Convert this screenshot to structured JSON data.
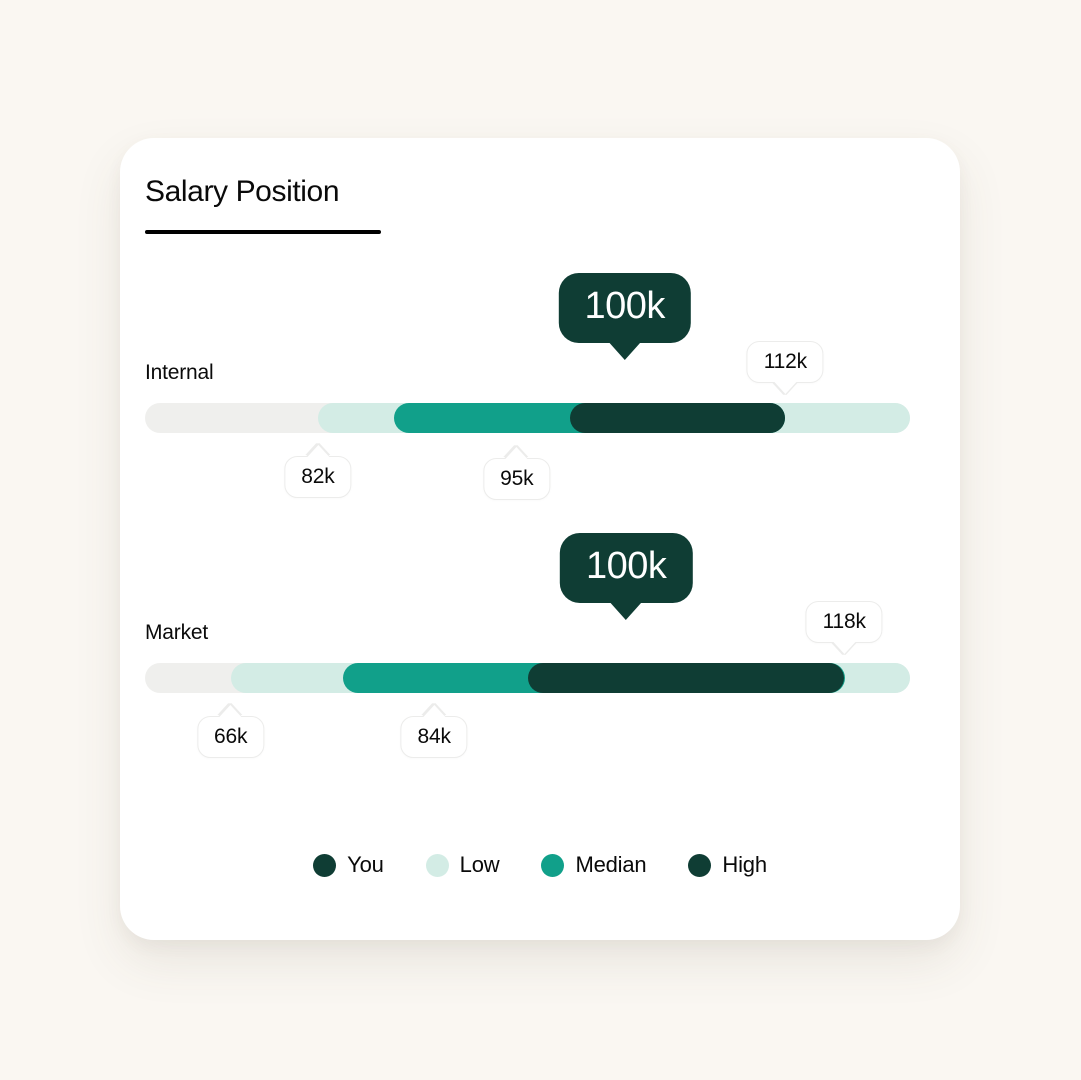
{
  "card": {
    "title": "Salary Position"
  },
  "colors": {
    "background": "#faf7f2",
    "card": "#ffffff",
    "track": "#efefed",
    "you": "#0f3d34",
    "low": "#d3ece5",
    "median": "#11a08a",
    "high": "#0f3d34",
    "text": "#0a0a0a"
  },
  "rows": [
    {
      "label": "Internal",
      "you": {
        "text": "100k",
        "left_pct": 62.7
      },
      "low": {
        "text": "82k",
        "left_pct": 22.6
      },
      "median": {
        "text": "95k",
        "left_pct": 48.6
      },
      "high": {
        "text": "112k",
        "left_pct": 83.7
      }
    },
    {
      "label": "Market",
      "you": {
        "text": "100k",
        "left_pct": 62.9
      },
      "low": {
        "text": "66k",
        "left_pct": 11.2
      },
      "median": {
        "text": "84k",
        "left_pct": 37.8
      },
      "high": {
        "text": "118k",
        "left_pct": 91.4
      }
    }
  ],
  "legend": [
    {
      "label": "You",
      "color": "#0f3d34"
    },
    {
      "label": "Low",
      "color": "#d3ece5"
    },
    {
      "label": "Median",
      "color": "#11a08a"
    },
    {
      "label": "High",
      "color": "#0f3d34"
    }
  ],
  "chart_data": {
    "type": "bar",
    "title": "Salary Position",
    "xlabel": "",
    "ylabel": "",
    "categories": [
      "Internal",
      "Market"
    ],
    "series": [
      {
        "name": "Low",
        "values": [
          82000,
          66000
        ],
        "labels": [
          "82k",
          "66k"
        ],
        "color": "#d3ece5"
      },
      {
        "name": "Median",
        "values": [
          95000,
          84000
        ],
        "labels": [
          "95k",
          "84k"
        ],
        "color": "#11a08a"
      },
      {
        "name": "High",
        "values": [
          112000,
          118000
        ],
        "labels": [
          "112k",
          "118k"
        ],
        "color": "#0f3d34"
      },
      {
        "name": "You",
        "values": [
          100000,
          100000
        ],
        "labels": [
          "100k",
          "100k"
        ],
        "color": "#0f3d34"
      }
    ],
    "legend_position": "bottom",
    "grid": false
  }
}
